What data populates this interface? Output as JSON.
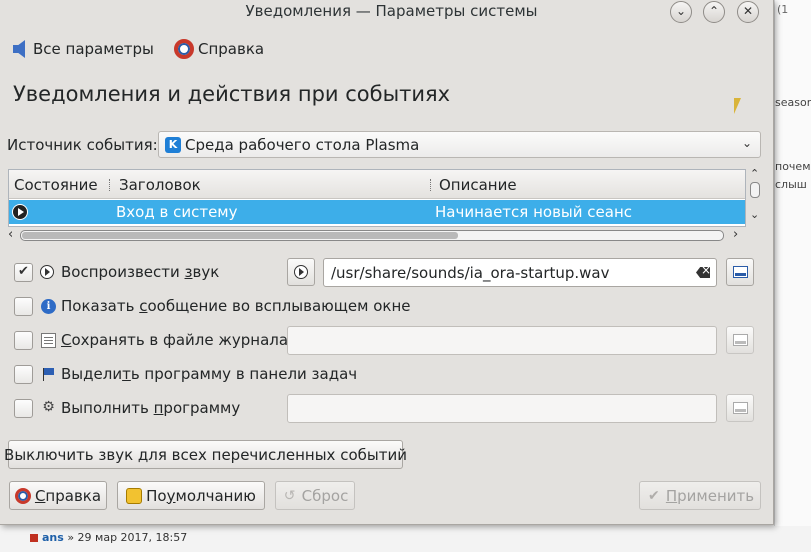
{
  "window": {
    "title": "Уведомления — Параметры системы",
    "controls": {
      "minimize": "⌄",
      "maximize": "⌃",
      "close": "✕"
    }
  },
  "toolbar": {
    "back_label": "Все параметры",
    "help_label": "Справка"
  },
  "page_title": "Уведомления и действия при событиях",
  "source": {
    "label": "Источник события:",
    "value": "Среда рабочего стола Plasma",
    "icon": "kde-icon"
  },
  "events_table": {
    "columns": [
      "Состояние",
      "Заголовок",
      "Описание"
    ],
    "rows": [
      {
        "state_icon": "play-icon",
        "title": "Вход в систему",
        "description": "Начинается новый сеанс",
        "selected": true
      }
    ]
  },
  "options": {
    "play_sound": {
      "pre": "Воспроизвести ",
      "accel": "з",
      "post": "вук",
      "checked": true,
      "icon": "play-icon",
      "path": "/usr/share/sounds/ia_ora-startup.wav"
    },
    "show_popup": {
      "pre": "Показать ",
      "accel": "с",
      "post": "ообщение во всплывающем окне",
      "checked": false,
      "icon": "info-icon"
    },
    "log_file": {
      "pre": "",
      "accel": "С",
      "post": "охранять в файле журнала",
      "checked": false,
      "icon": "log-icon",
      "path": ""
    },
    "taskbar": {
      "pre": "Выдели",
      "accel": "т",
      "post": "ь программу в панели задач",
      "checked": false,
      "icon": "flag-icon"
    },
    "run_program": {
      "pre": "Выполнить ",
      "accel": "п",
      "post": "рограмму",
      "checked": false,
      "icon": "gear-icon",
      "path": ""
    }
  },
  "buttons": {
    "mute_all": "Выключить звук для всех перечисленных событий",
    "help": {
      "accel": "С",
      "rest": "правка"
    },
    "defaults": {
      "pre": "По ",
      "accel": "у",
      "rest": "молчанию"
    },
    "reset": "Сброс",
    "apply": {
      "accel": "П",
      "rest": "рименить"
    }
  },
  "background_page": {
    "snippets": [
      "seasons",
      "почем",
      "слыш"
    ],
    "footer_author": "ans",
    "footer_date": "» 29 мар 2017, 18:57",
    "top_fragment": "(1"
  },
  "colors": {
    "selection": "#3daee9",
    "window_bg": "#e3e1de",
    "accent_blue": "#2a5ca8"
  }
}
